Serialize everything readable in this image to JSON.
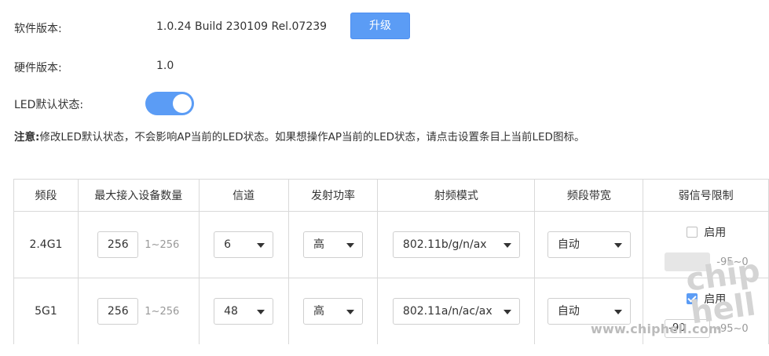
{
  "info": {
    "software_label": "软件版本:",
    "software_value": "1.0.24 Build 230109 Rel.07239",
    "upgrade_button": "升级",
    "hardware_label": "硬件版本:",
    "hardware_value": "1.0",
    "led_label": "LED默认状态:",
    "led_on": true
  },
  "notice": {
    "prefix": "注意:",
    "text": "修改LED默认状态，不会影响AP当前的LED状态。如果想操作AP当前的LED状态，请点击设置条目上当前LED图标。"
  },
  "table": {
    "headers": [
      "频段",
      "最大接入设备数量",
      "信道",
      "发射功率",
      "射频模式",
      "频段带宽",
      "弱信号限制"
    ],
    "rows": [
      {
        "band": "2.4G1",
        "max_clients": "256",
        "max_clients_range": "1~256",
        "channel": "6",
        "power": "高",
        "mode": "802.11b/g/n/ax",
        "bandwidth": "自动",
        "weak_enable_label": "启用",
        "weak_enabled": false,
        "weak_value": "",
        "weak_range": "-95~0"
      },
      {
        "band": "5G1",
        "max_clients": "256",
        "max_clients_range": "1~256",
        "channel": "48",
        "power": "高",
        "mode": "802.11a/n/ac/ax",
        "bandwidth": "自动",
        "weak_enable_label": "启用",
        "weak_enabled": true,
        "weak_value": "-90",
        "weak_range": "-95~0"
      }
    ]
  },
  "watermark": {
    "url": "www.chiphell.com",
    "logo": "chiphell"
  },
  "colors": {
    "accent": "#5b9cf5",
    "border": "#d9d9d9",
    "muted": "#999999"
  }
}
